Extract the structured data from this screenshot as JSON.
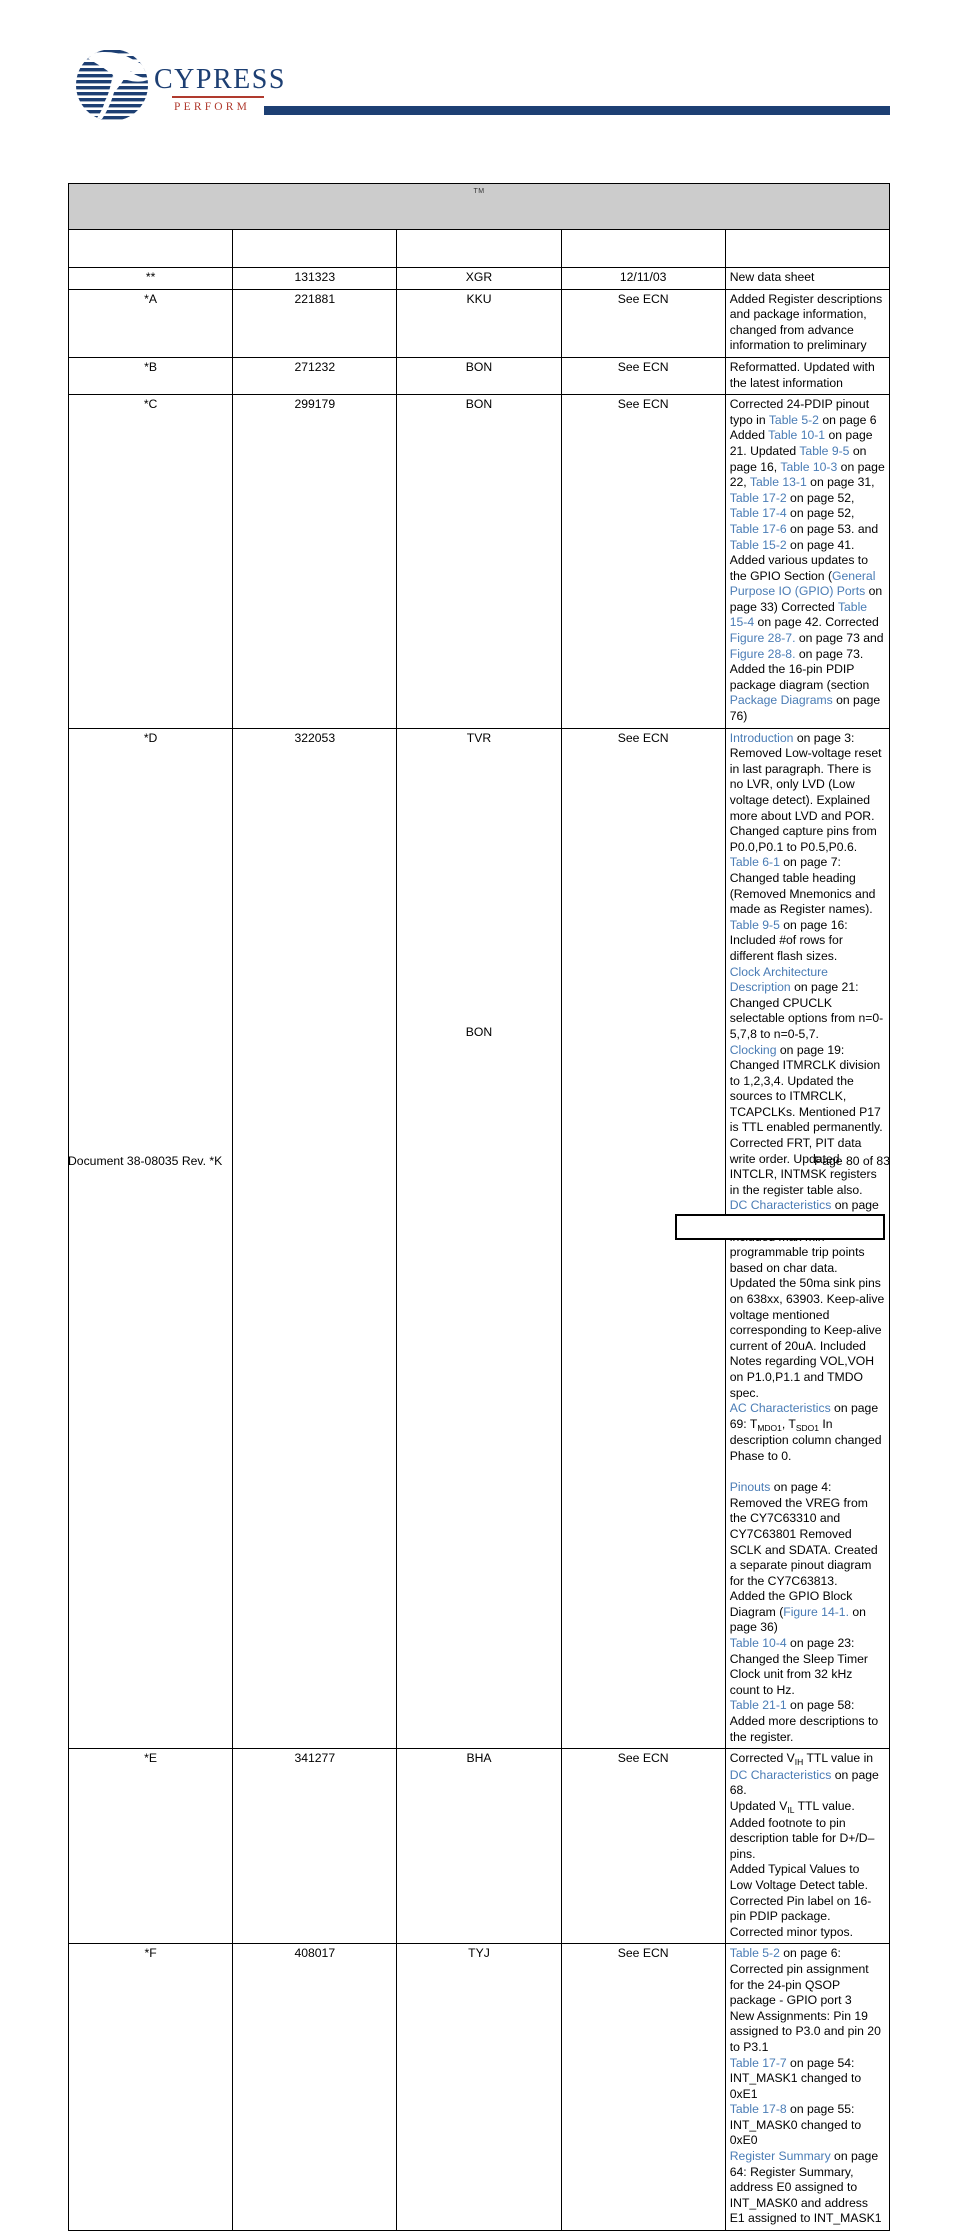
{
  "brand": {
    "name": "CYPRESS",
    "tagline": "PERFORM",
    "navy": "#1d3f73",
    "red": "#b03a2e"
  },
  "document_title": {
    "text": "",
    "trademark": "TM"
  },
  "table": {
    "columns": [
      {
        "key": "revision",
        "label": ""
      },
      {
        "key": "ecn",
        "label": ""
      },
      {
        "key": "originator",
        "label": ""
      },
      {
        "key": "date",
        "label": ""
      },
      {
        "key": "description",
        "label": ""
      }
    ],
    "rows": [
      {
        "revision": "**",
        "ecn": "131323",
        "originator": "XGR",
        "originator2": "",
        "date": "12/11/03",
        "description_blocks": [
          {
            "parts": [
              {
                "t": "New data sheet"
              }
            ]
          }
        ]
      },
      {
        "revision": "*A",
        "ecn": "221881",
        "originator": "KKU",
        "originator2": "",
        "date": "See ECN",
        "description_blocks": [
          {
            "parts": [
              {
                "t": "Added Register descriptions and package information, changed from advance information to preliminary"
              }
            ]
          }
        ]
      },
      {
        "revision": "*B",
        "ecn": "271232",
        "originator": "BON",
        "originator2": "",
        "date": "See ECN",
        "description_blocks": [
          {
            "parts": [
              {
                "t": "Reformatted. Updated with the latest information"
              }
            ]
          }
        ]
      },
      {
        "revision": "*C",
        "ecn": "299179",
        "originator": "BON",
        "originator2": "",
        "date": "See ECN",
        "description_blocks": [
          {
            "parts": [
              {
                "t": "Corrected 24-PDIP pinout typo in "
              },
              {
                "t": "Table 5-2",
                "link": true
              },
              {
                "t": " on page 6 Added "
              },
              {
                "t": "Table 10-1",
                "link": true
              },
              {
                "t": " on page 21. Updated "
              },
              {
                "t": "Table 9-5",
                "link": true
              },
              {
                "t": " on page 16, "
              },
              {
                "t": "Table 10-3",
                "link": true
              },
              {
                "t": " on page 22, "
              },
              {
                "t": "Table 13-1",
                "link": true
              },
              {
                "t": " on page 31, "
              },
              {
                "t": "Table 17-2",
                "link": true
              },
              {
                "t": " on page 52, "
              },
              {
                "t": "Table 17-4",
                "link": true
              },
              {
                "t": " on page 52, "
              },
              {
                "t": "Table 17-6",
                "link": true
              },
              {
                "t": " on page 53. and "
              },
              {
                "t": "Table 15-2",
                "link": true
              },
              {
                "t": " on page 41. Added various updates to the GPIO Section ("
              },
              {
                "t": "General Purpose IO (GPIO) Ports",
                "link": true
              },
              {
                "t": " on page 33) Corrected "
              },
              {
                "t": "Table 15-4",
                "link": true
              },
              {
                "t": " on page 42. Corrected "
              },
              {
                "t": "Figure 28-7.",
                "link": true
              },
              {
                "t": " on page 73 and "
              },
              {
                "t": "Figure 28-8.",
                "link": true
              },
              {
                "t": " on page 73. Added the 16-pin PDIP package diagram (section "
              },
              {
                "t": "Package Diagrams",
                "link": true
              },
              {
                "t": " on page 76)"
              }
            ]
          }
        ]
      },
      {
        "revision": "*D",
        "ecn": "322053",
        "originator": "TVR",
        "originator2": "BON",
        "date": "See ECN",
        "description_blocks": [
          {
            "parts": [
              {
                "t": "Introduction",
                "link": true
              },
              {
                "t": " on page 3: Removed Low-voltage reset in last paragraph. There is no LVR, only LVD (Low voltage detect). Explained more about LVD and POR. Changed capture pins from P0.0,P0.1 to P0.5,P0.6."
              }
            ]
          },
          {
            "parts": [
              {
                "t": "Table 6-1",
                "link": true
              },
              {
                "t": " on page 7: Changed table heading (Removed Mnemonics and made as Register names)."
              }
            ]
          },
          {
            "parts": [
              {
                "t": "Table 9-5",
                "link": true
              },
              {
                "t": " on page 16: Included #of rows for different flash sizes."
              }
            ]
          },
          {
            "parts": [
              {
                "t": "Clock Architecture Description",
                "link": true
              },
              {
                "t": " on page 21: Changed CPUCLK selectable options from n=0-5,7,8 to n=0-5,7."
              }
            ]
          },
          {
            "parts": [
              {
                "t": "Clocking",
                "link": true
              },
              {
                "t": " on page 19: Changed ITMRCLK division to 1,2,3,4. Updated the sources to ITMRCLK, TCAPCLKs. Mentioned P17 is TTL enabled permanently. Corrected FRT, PIT data write order. Updated INTCLR, INTMSK registers in the register table also."
              }
            ]
          },
          {
            "parts": [
              {
                "t": "DC Characteristics",
                "link": true
              },
              {
                "t": " on page 68: changed LVR to LVD included max min programmable trip points based on char data. Updated the 50ma sink pins on 638xx, 63903. Keep-alive voltage mentioned corresponding to Keep-alive current of 20uA. Included Notes regarding VOL,VOH on P1.0,P1.1 and TMDO spec."
              }
            ]
          },
          {
            "parts": [
              {
                "t": "AC Characteristics",
                "link": true
              },
              {
                "t": " on page 69: T"
              },
              {
                "t": "MDO1",
                "sub": true
              },
              {
                "t": ", T"
              },
              {
                "t": "SDO1",
                "sub": true
              },
              {
                "t": " In description column changed Phase to 0."
              }
            ]
          },
          {
            "spacer": true
          },
          {
            "parts": [
              {
                "t": "Pinouts",
                "link": true
              },
              {
                "t": " on page 4: Removed the VREG from the CY7C63310 and CY7C63801 Removed SCLK and SDATA. Created a separate pinout diagram for the CY7C63813."
              }
            ]
          },
          {
            "parts": [
              {
                "t": "Added the GPIO Block Diagram ("
              },
              {
                "t": "Figure 14-1.",
                "link": true
              },
              {
                "t": " on page 36)"
              }
            ]
          },
          {
            "parts": [
              {
                "t": "Table 10-4",
                "link": true
              },
              {
                "t": " on page 23: Changed the Sleep Timer Clock unit from 32 kHz count to Hz."
              }
            ]
          },
          {
            "parts": [
              {
                "t": "Table 21-1",
                "link": true
              },
              {
                "t": " on page 58: Added more descriptions to the register."
              }
            ]
          }
        ]
      },
      {
        "revision": "*E",
        "ecn": "341277",
        "originator": "BHA",
        "originator2": "",
        "date": "See ECN",
        "description_blocks": [
          {
            "parts": [
              {
                "t": "Corrected V"
              },
              {
                "t": "IH",
                "sub": true
              },
              {
                "t": " TTL value in "
              },
              {
                "t": "DC Characteristics",
                "link": true
              },
              {
                "t": " on page 68."
              }
            ]
          },
          {
            "parts": [
              {
                "t": "Updated V"
              },
              {
                "t": "IL",
                "sub": true
              },
              {
                "t": " TTL value."
              }
            ]
          },
          {
            "parts": [
              {
                "t": "Added footnote to pin description table for D+/D– pins."
              }
            ]
          },
          {
            "parts": [
              {
                "t": "Added Typical Values to Low Voltage Detect table."
              }
            ]
          },
          {
            "parts": [
              {
                "t": "Corrected Pin label on 16-pin PDIP package."
              }
            ]
          },
          {
            "parts": [
              {
                "t": "Corrected minor typos."
              }
            ]
          }
        ]
      },
      {
        "revision": "*F",
        "ecn": "408017",
        "originator": "TYJ",
        "originator2": "",
        "date": "See ECN",
        "description_blocks": [
          {
            "parts": [
              {
                "t": "Table 5-2",
                "link": true
              },
              {
                "t": " on page 6: Corrected pin assignment for the 24-pin QSOP package - GPIO port 3"
              }
            ]
          },
          {
            "parts": [
              {
                "t": "New Assignments: Pin 19 assigned to P3.0 and pin 20 to P3.1"
              }
            ]
          },
          {
            "parts": [
              {
                "t": "Table 17-7",
                "link": true
              },
              {
                "t": " on page 54: INT_MASK1 changed to 0xE1"
              }
            ]
          },
          {
            "parts": [
              {
                "t": "Table 17-8",
                "link": true
              },
              {
                "t": " on page 55: INT_MASK0 changed to 0xE0"
              }
            ]
          },
          {
            "parts": [
              {
                "t": "Register Summary",
                "link": true
              },
              {
                "t": " on page 64: Register Summary, address E0 assigned to INT_MASK0 and address E1 assigned to INT_MASK1"
              }
            ]
          }
        ]
      }
    ]
  },
  "footer": {
    "document_id": "Document 38-08035 Rev. *K",
    "page_label": "Page 80 of 83"
  }
}
